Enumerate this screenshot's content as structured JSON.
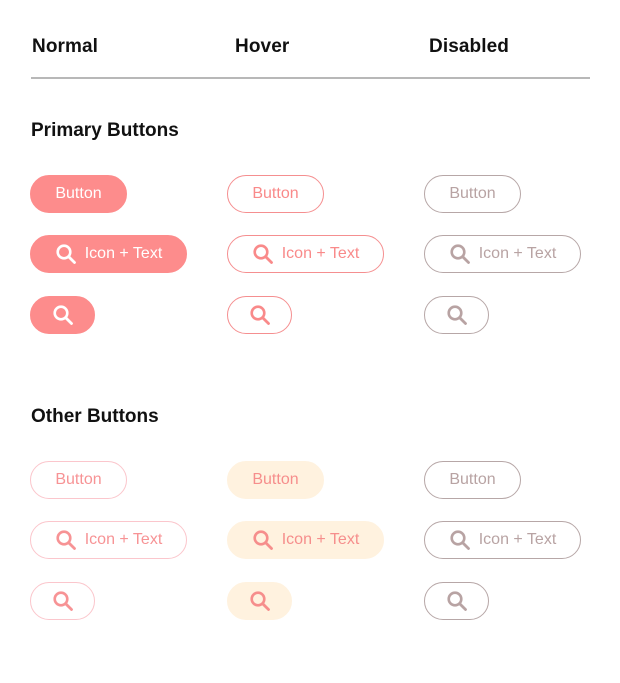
{
  "columns": {
    "normal": "Normal",
    "hover": "Hover",
    "disabled": "Disabled"
  },
  "sections": {
    "primary": "Primary Buttons",
    "other": "Other Buttons"
  },
  "buttons": {
    "text_label": "Button",
    "icon_text_label": "Icon + Text",
    "icon": "search-icon"
  },
  "colors": {
    "primary": "#fd8c8c",
    "primary_text": "#ffffff",
    "hover_outline": "#f58f90",
    "disabled": "#b8a3a3",
    "other_border": "#fbc6cc",
    "other_hover_bg": "#fff2df",
    "divider": "#b8b8b8"
  }
}
